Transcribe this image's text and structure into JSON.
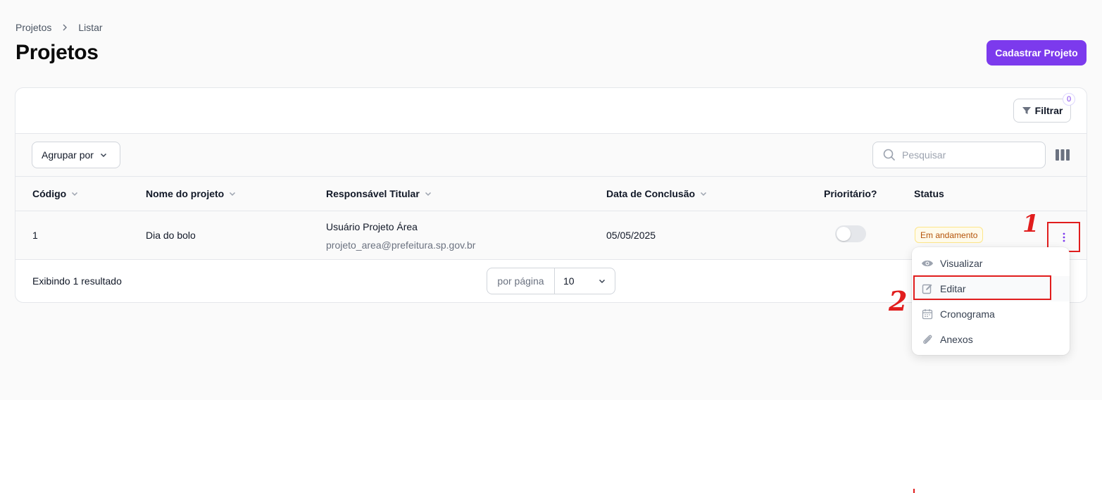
{
  "breadcrumb": {
    "items": [
      "Projetos",
      "Listar"
    ]
  },
  "page": {
    "title": "Projetos",
    "primary_action": "Cadastrar Projeto"
  },
  "filter": {
    "label": "Filtrar",
    "count": "0"
  },
  "toolbar": {
    "group_by": "Agrupar por",
    "search_placeholder": "Pesquisar"
  },
  "table": {
    "columns": [
      "Código",
      "Nome do projeto",
      "Responsável Titular",
      "Data de Conclusão",
      "Prioritário?",
      "Status"
    ],
    "rows": [
      {
        "codigo": "1",
        "nome": "Dia do bolo",
        "responsavel_nome": "Usuário Projeto Área",
        "responsavel_email": "projeto_area@prefeitura.sp.gov.br",
        "data_conclusao": "05/05/2025",
        "prioritario": false,
        "status": "Em andamento"
      }
    ]
  },
  "footer": {
    "result_text": "Exibindo 1 resultado",
    "per_page_label": "por página",
    "per_page_value": "10"
  },
  "row_menu": {
    "items": [
      "Visualizar",
      "Editar",
      "Cronograma",
      "Anexos"
    ]
  },
  "annotations": {
    "step1": "1",
    "step2": "2"
  },
  "colors": {
    "accent": "#7c3aed",
    "annotation": "#e11d1d",
    "status_warning": "#b45309"
  }
}
